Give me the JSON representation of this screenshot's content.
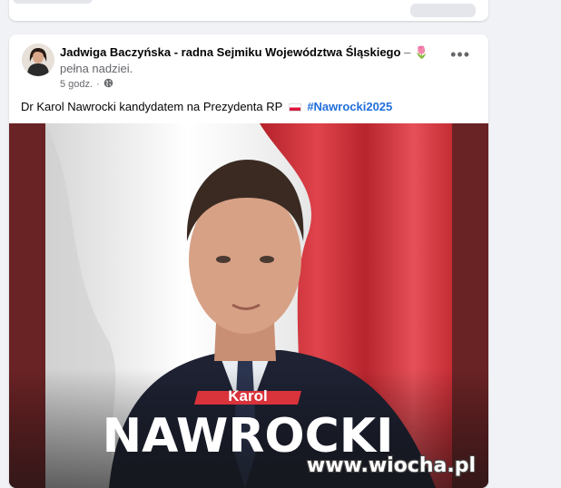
{
  "post": {
    "author": "Jadwiga Baczyńska - radna Sejmiku Województwa Śląskiego",
    "author_suffix": "–",
    "feeling_emoji": "🌷",
    "feeling_text": "pełna nadziei.",
    "time": "5 godz.",
    "audience_icon": "globe-icon",
    "more_icon": "more-options-icon",
    "text": "Dr Karol Nawrocki kandydatem na Prezydenta RP",
    "flag_icon": "poland-flag-icon",
    "hashtag": "#Nawrocki2025"
  },
  "poster": {
    "first_name": "Karol",
    "last_name": "NAWROCKI"
  },
  "watermark": "www.wiocha.pl",
  "colors": {
    "accent": "#216fdb",
    "poster_red": "#d9333b",
    "poster_frame": "#6a2325"
  }
}
